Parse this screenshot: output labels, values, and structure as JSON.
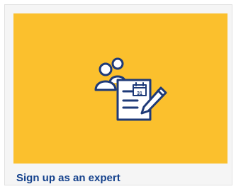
{
  "card": {
    "title": "Sign up as an expert",
    "banner_icon": "expert-signup-icon",
    "calendar_day": "31"
  },
  "colors": {
    "banner_bg": "#fbc02d",
    "icon_stroke": "#1e3a78",
    "icon_fill": "#ffffff",
    "link_text": "#14418c",
    "card_bg": "#f5f5f5"
  }
}
